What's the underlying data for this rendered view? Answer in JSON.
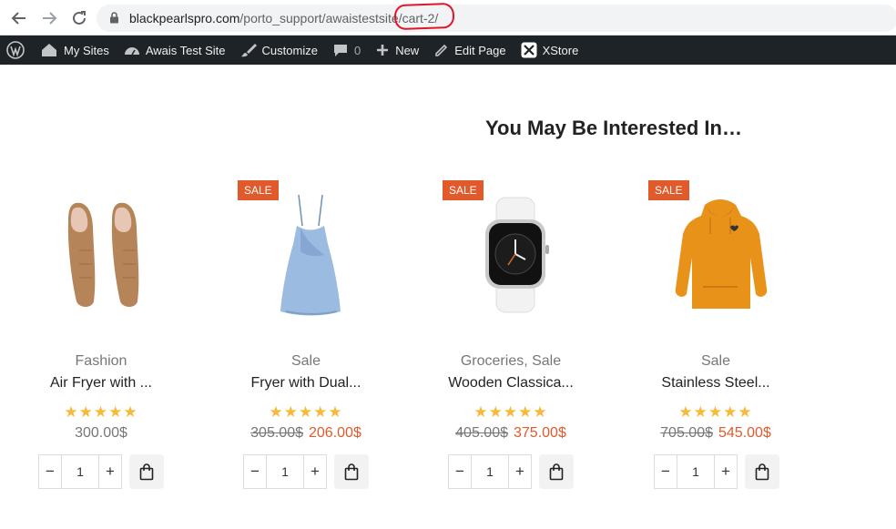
{
  "browser": {
    "url_host": "blackpearlspro.com",
    "url_path": "/porto_support/awaistestsite",
    "url_tail": "/cart-2/"
  },
  "admin_bar": {
    "my_sites": "My Sites",
    "site_name": "Awais Test Site",
    "customize": "Customize",
    "comments_count": "0",
    "new": "New",
    "edit_page": "Edit Page",
    "xstore": "XStore"
  },
  "section": {
    "title": "You May Be Interested In…"
  },
  "products": [
    {
      "image": "shoes",
      "category": "Fashion",
      "name": "Air Fryer with ...",
      "stars": "★★★★★",
      "sale_badge": "",
      "old_price": "",
      "price": "300.00$",
      "qty": "1",
      "minus": "−",
      "plus": "+"
    },
    {
      "image": "dress",
      "category": "Sale",
      "name": "Fryer with Dual...",
      "stars": "★★★★★",
      "sale_badge": "SALE",
      "old_price": "305.00$",
      "price": "206.00$",
      "qty": "1",
      "minus": "−",
      "plus": "+"
    },
    {
      "image": "watch",
      "category": "Groceries, Sale",
      "name": "Wooden Classica...",
      "stars": "★★★★★",
      "sale_badge": "SALE",
      "old_price": "405.00$",
      "price": "375.00$",
      "qty": "1",
      "minus": "−",
      "plus": "+"
    },
    {
      "image": "hoodie",
      "category": "Sale",
      "name": "Stainless Steel...",
      "stars": "★★★★★",
      "sale_badge": "SALE",
      "old_price": "705.00$",
      "price": "545.00$",
      "qty": "1",
      "minus": "−",
      "plus": "+"
    }
  ],
  "colors": {
    "accent": "#e05a2b",
    "stars": "#f6b93b",
    "admin_bar": "#1d2327"
  }
}
